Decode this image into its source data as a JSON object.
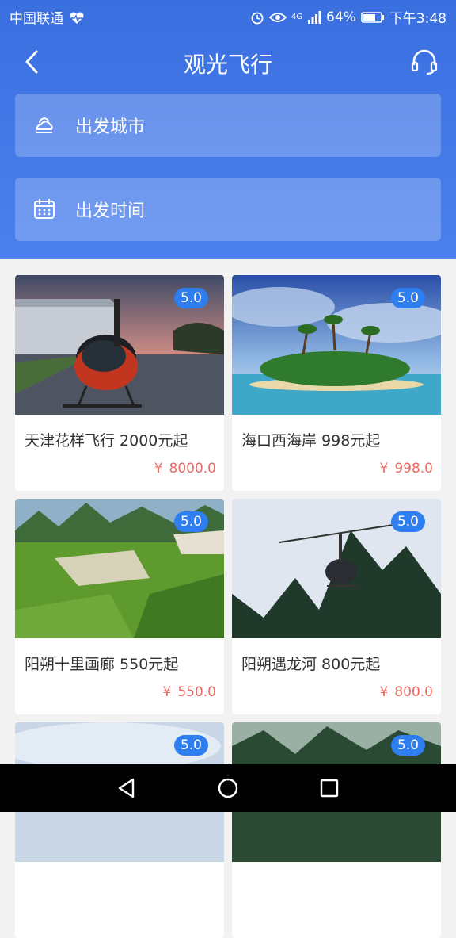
{
  "status_bar": {
    "carrier": "中国联通",
    "battery": "64%",
    "network": "4G",
    "time": "下午3:48"
  },
  "header": {
    "title": "观光飞行"
  },
  "fields": {
    "departure_city": "出发城市",
    "departure_time": "出发时间"
  },
  "cards": [
    {
      "name": "天津花样飞行 2000元起",
      "currency": "¥",
      "price": "8000.0",
      "rating": "5.0"
    },
    {
      "name": "海口西海岸 998元起",
      "currency": "¥",
      "price": "998.0",
      "rating": "5.0"
    },
    {
      "name": "阳朔十里画廊 550元起",
      "currency": "¥",
      "price": "550.0",
      "rating": "5.0"
    },
    {
      "name": "阳朔遇龙河 800元起",
      "currency": "¥",
      "price": "800.0",
      "rating": "5.0"
    },
    {
      "rating": "5.0"
    },
    {
      "rating": "5.0"
    }
  ],
  "colors": {
    "header_blue": "#3a6fe0",
    "badge_blue": "#2f7ef0",
    "price_red": "#e86a64"
  },
  "icons": [
    "heartbeat-icon",
    "alarm-icon",
    "eye-icon",
    "signal-icon",
    "battery-icon",
    "back-icon",
    "headset-icon",
    "cloud-sun-icon",
    "calendar-icon",
    "nav-back-icon",
    "nav-home-icon",
    "nav-recent-icon"
  ]
}
